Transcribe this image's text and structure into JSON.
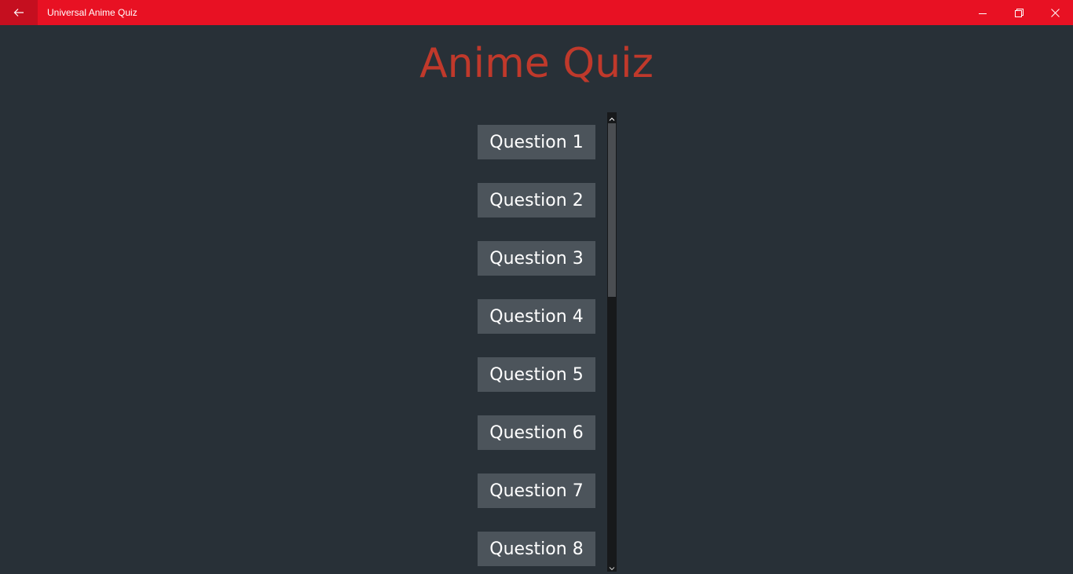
{
  "window": {
    "title": "Universal Anime Quiz",
    "titlebar_color": "#e81123",
    "back_button_color": "#c50f1f"
  },
  "icons": {
    "back": "back-arrow-icon",
    "minimize": "minimize-icon",
    "maximize": "restore-icon",
    "close": "close-icon",
    "scroll_up": "chevron-up-icon",
    "scroll_down": "chevron-down-icon"
  },
  "main": {
    "heading": "Anime Quiz",
    "heading_color": "#c0392b",
    "background_color": "#283037",
    "questions": [
      {
        "label": "Question 1"
      },
      {
        "label": "Question 2"
      },
      {
        "label": "Question 3"
      },
      {
        "label": "Question 4"
      },
      {
        "label": "Question 5"
      },
      {
        "label": "Question 6"
      },
      {
        "label": "Question 7"
      },
      {
        "label": "Question 8"
      }
    ]
  }
}
